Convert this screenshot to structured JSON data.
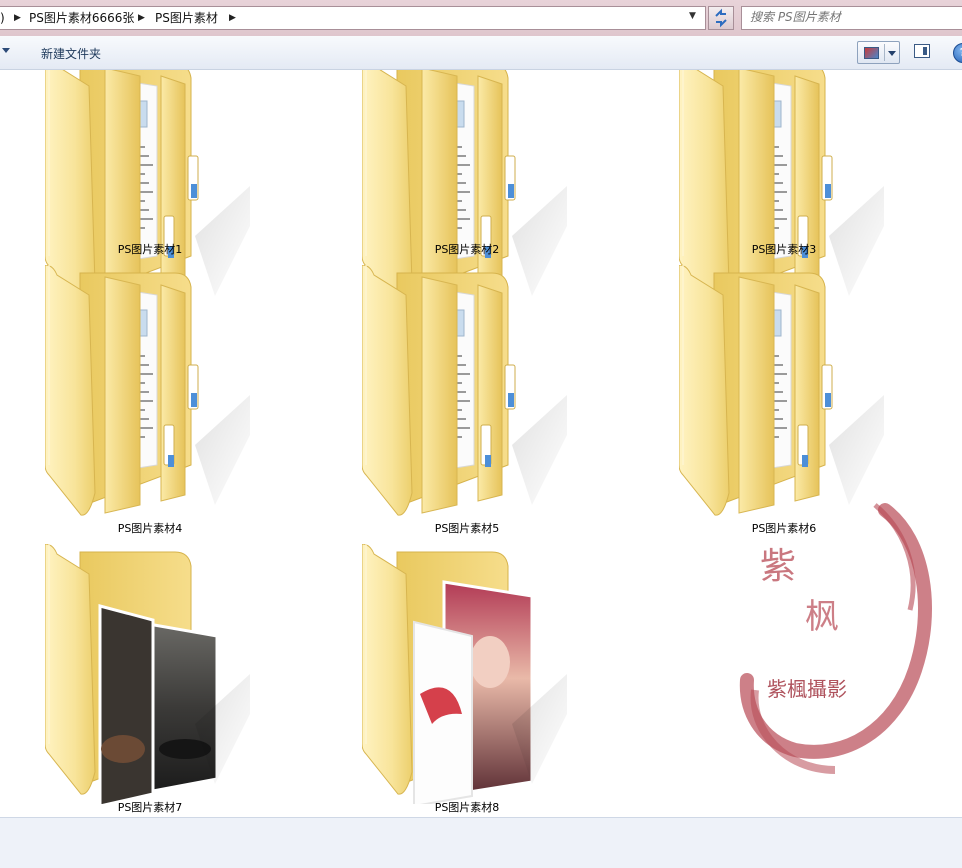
{
  "address": {
    "crumbs": [
      ")",
      "PS图片素材6666张",
      "PS图片素材"
    ],
    "search_placeholder": "搜索 PS图片素材"
  },
  "toolbar": {
    "new_folder_label": "新建文件夹",
    "icons": [
      "organize-dropdown-icon",
      "view-mode-icon",
      "preview-pane-icon",
      "help-icon"
    ]
  },
  "folders": [
    {
      "name": "PS图片素材1",
      "thumbnail": "documents"
    },
    {
      "name": "PS图片素材2",
      "thumbnail": "documents"
    },
    {
      "name": "PS图片素材3",
      "thumbnail": "documents"
    },
    {
      "name": "PS图片素材4",
      "thumbnail": "documents"
    },
    {
      "name": "PS图片素材5",
      "thumbnail": "documents"
    },
    {
      "name": "PS图片素材6",
      "thumbnail": "documents"
    },
    {
      "name": "PS图片素材7",
      "thumbnail": "car-photos"
    },
    {
      "name": "PS图片素材8",
      "thumbnail": "portrait-photos"
    }
  ],
  "watermark": {
    "text": "紫楓攝影",
    "seal": "紫枫",
    "color": "#b84a55"
  },
  "colors": {
    "folder": "#f3d77a",
    "folder_light": "#fbeeb4",
    "address_bar": "#e3ccd3"
  }
}
